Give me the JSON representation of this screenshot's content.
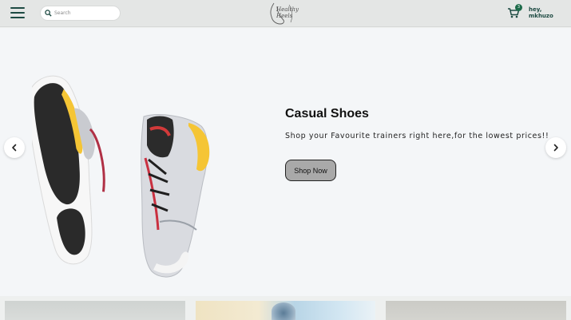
{
  "header": {
    "search_placeholder": "Search",
    "logo_text": "Healthy Heels",
    "cart_count": "3",
    "greeting_line1": "hey,",
    "greeting_line2": "mkhuzo"
  },
  "hero": {
    "title": "Casual Shoes",
    "subtitle": "Shop your Favourite trainers right here,for the lowest prices!!",
    "button_label": "Shop Now"
  },
  "icons": {
    "menu": "hamburger-icon",
    "search": "search-icon",
    "cart": "cart-icon",
    "prev": "chevron-left-icon",
    "next": "chevron-right-icon"
  },
  "colors": {
    "brand_green": "#1d4a42",
    "badge_green": "#1d6b4a",
    "button_gray": "#a9a9a9",
    "hero_bg": "#f4f6f8"
  }
}
